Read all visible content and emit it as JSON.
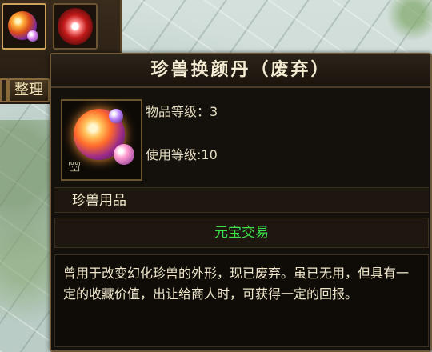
{
  "inventory": {
    "sort_label": "整理",
    "slots": [
      {
        "icon": "orb-pill-icon",
        "selected": true
      },
      {
        "icon": "red-gem-icon",
        "selected": false
      }
    ]
  },
  "tooltip": {
    "title": "珍兽换颜丹（废弃）",
    "item_level": "物品等级：3",
    "use_level": "使用等级:10",
    "category": "珍兽用品",
    "trade": "元宝交易",
    "description": "曾用于改变幻化珍兽的外形，现已废弃。虽已无用，但具有一定的收藏价值，出让给商人时，可获得一定的回报。",
    "colors": {
      "trade_text": "#3ee04a",
      "title_text": "#f4ecd2",
      "border": "#6e5a3a"
    }
  }
}
